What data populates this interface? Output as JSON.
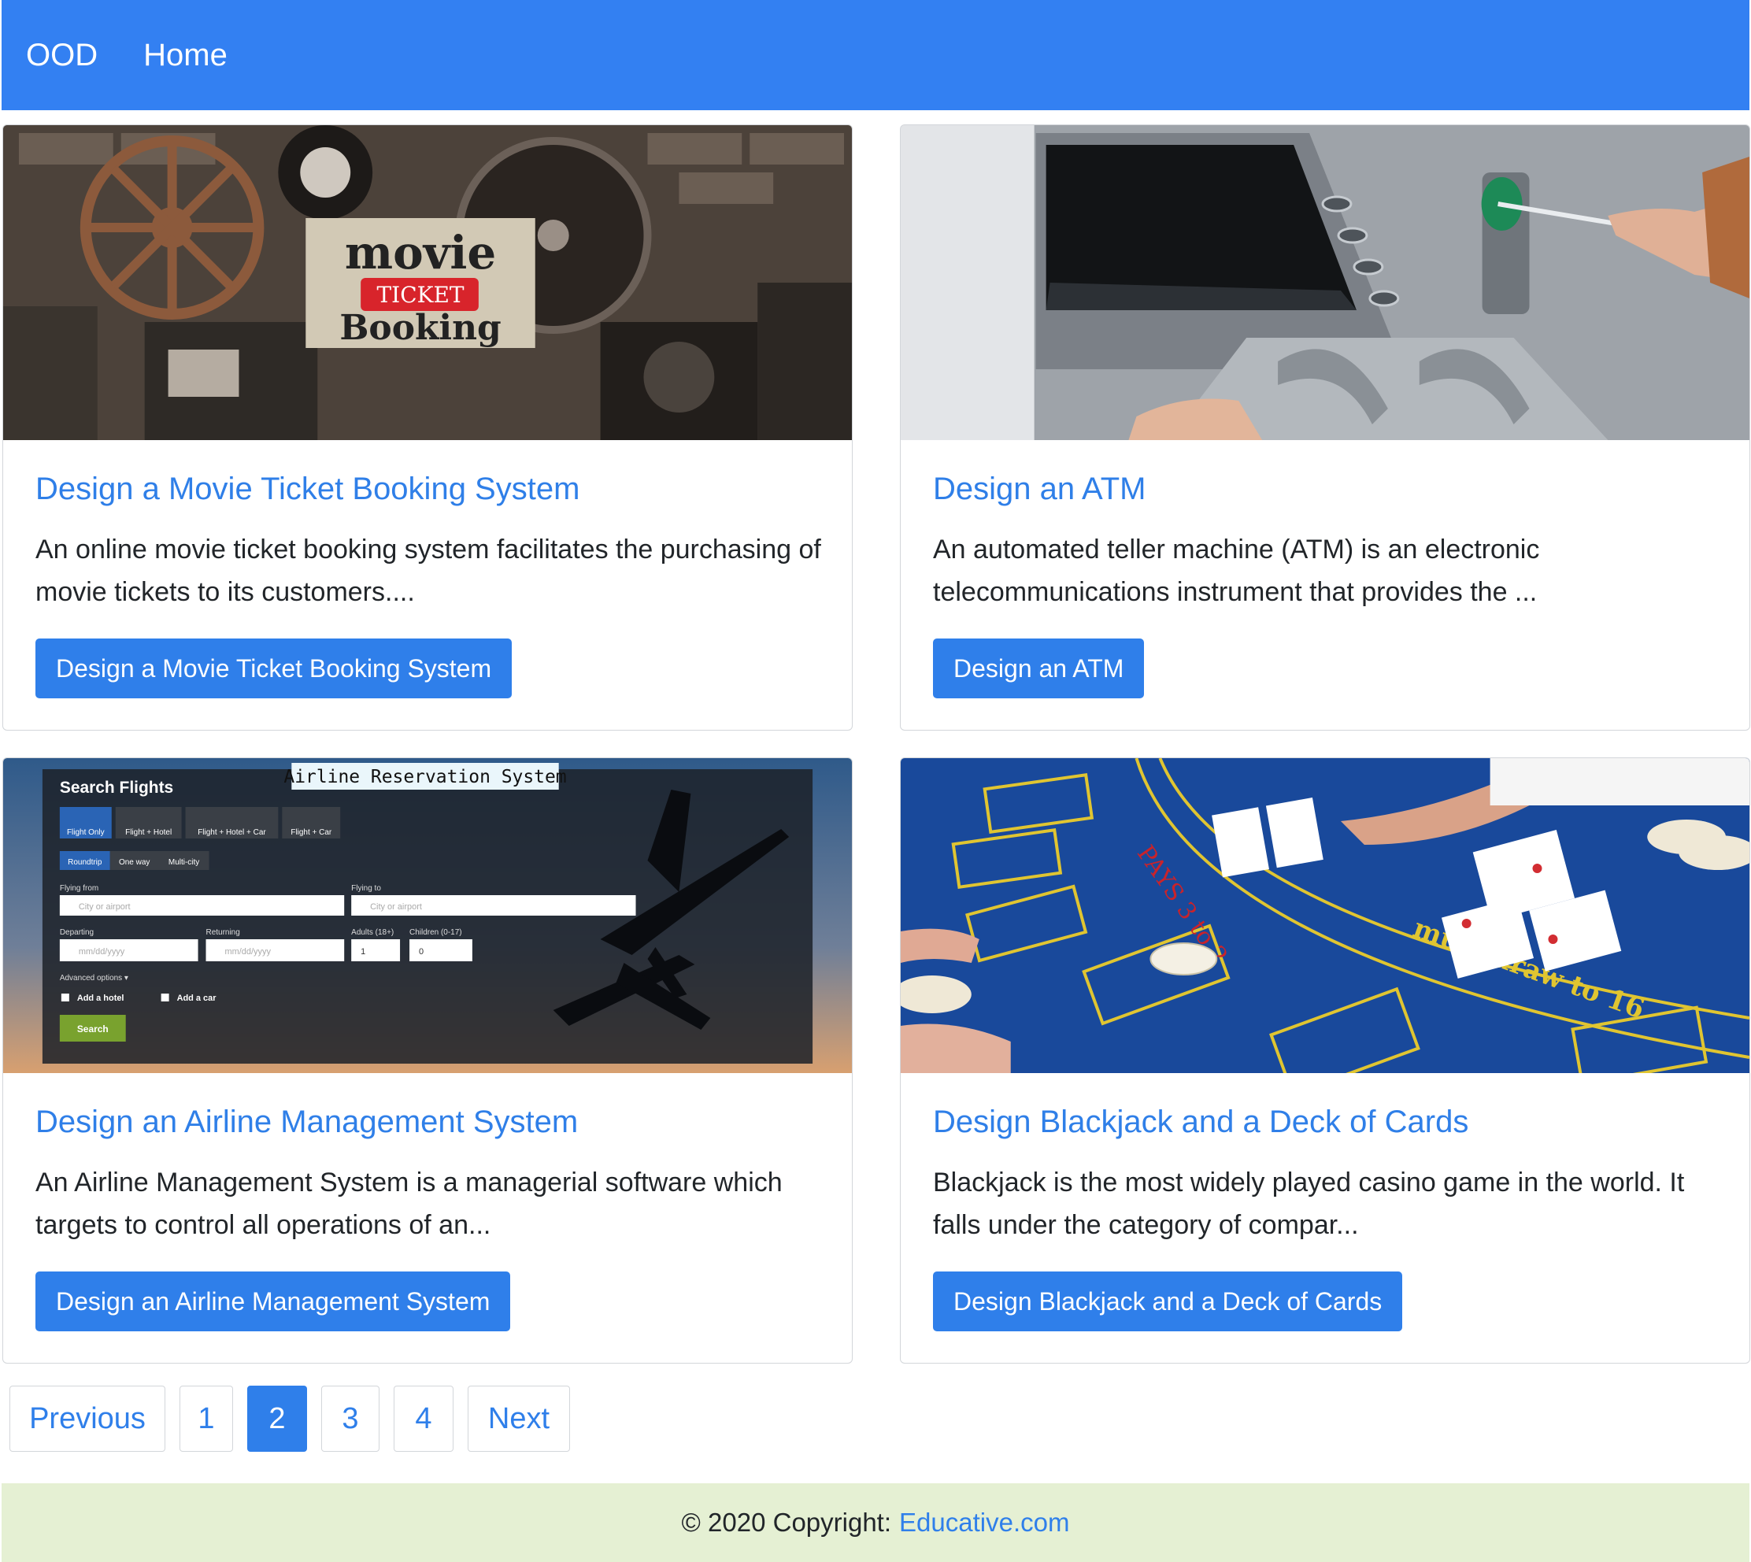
{
  "navbar": {
    "brand": "OOD",
    "home_link": "Home",
    "color": "#3380f2"
  },
  "cards": [
    {
      "title": "Design a Movie Ticket Booking System",
      "text": "An online movie ticket booking system facilitates the purchasing of movie tickets to its customers....",
      "button": "Design a Movie Ticket Booking System",
      "image": {
        "line1": "movie",
        "line2": "TICKET",
        "line3": "Booking"
      }
    },
    {
      "title": "Design an ATM",
      "text": "An automated teller machine (ATM) is an electronic telecommunications instrument that provides the ...",
      "button": "Design an ATM"
    },
    {
      "title": "Design an Airline Management System",
      "text": "An Airline Management System is a managerial software which targets to control all operations of an...",
      "button": "Design an Airline Management System",
      "image": {
        "banner": "Airline Reservation System",
        "heading": "Search Flights",
        "tabs": [
          "Flight Only",
          "Flight + Hotel",
          "Flight + Hotel + Car",
          "Flight + Car"
        ],
        "trip_types": [
          "Roundtrip",
          "One way",
          "Multi-city"
        ],
        "flying_from": "Flying from",
        "flying_to": "Flying to",
        "city_placeholder": "City or airport",
        "departing": "Departing",
        "returning": "Returning",
        "date_placeholder": "mm/dd/yyyy",
        "adults": "Adults (18+)",
        "children": "Children (0-17)",
        "adults_value": "1",
        "children_value": "0",
        "advanced": "Advanced options ▾",
        "add_hotel": "Add a hotel",
        "add_car": "Add a car",
        "search": "Search"
      }
    },
    {
      "title": "Design Blackjack and a Deck of Cards",
      "text": "Blackjack is the most widely played casino game in the world. It falls under the category of compar...",
      "button": "Design Blackjack and a Deck of Cards",
      "image": {
        "table_text": "must draw to 16",
        "pays_text": "PAYS 3 to 2"
      }
    }
  ],
  "pagination": {
    "previous": "Previous",
    "pages": [
      "1",
      "2",
      "3",
      "4"
    ],
    "active_page": "2",
    "next": "Next"
  },
  "footer": {
    "copyright": "© 2020 Copyright:",
    "link": "Educative.com"
  }
}
